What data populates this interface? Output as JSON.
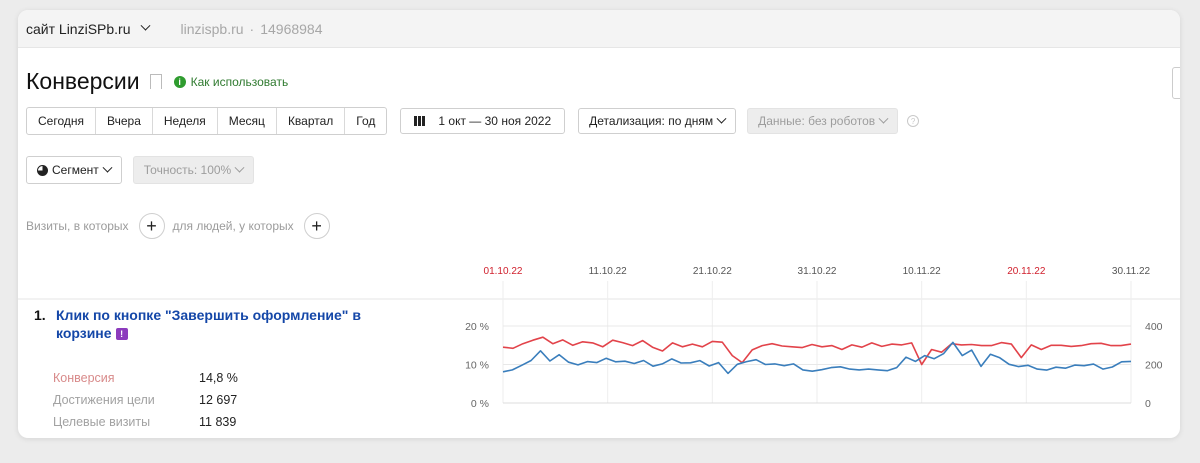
{
  "topbar": {
    "site_label": "сайт LinziSPb.ru",
    "domain": "linzispb.ru",
    "separator": "·",
    "counter_id": "14968984"
  },
  "page_title": "Конверсии",
  "help_link": "Как использовать",
  "info_glyph": "i",
  "periods": [
    "Сегодня",
    "Вчера",
    "Неделя",
    "Месяц",
    "Квартал",
    "Год"
  ],
  "date_range": "1 окт — 30 ноя 2022",
  "detail_label": "Детализация: по дням",
  "data_label": "Данные: без роботов",
  "help_glyph": "?",
  "segment_label": "Сегмент",
  "accuracy_label": "Точность: 100%",
  "filter": {
    "visits_label": "Визиты, в которых",
    "people_label": "для людей, у которых",
    "plus": "+"
  },
  "goal": {
    "number": "1.",
    "title": "Клик по кнопке \"Завершить оформление\" в корзине",
    "badge": "!",
    "stats": [
      {
        "label": "Конверсия",
        "value": "14,8 %"
      },
      {
        "label": "Достижения цели",
        "value": "12 697"
      },
      {
        "label": "Целевые визиты",
        "value": "11 839"
      }
    ]
  },
  "colors": {
    "conversion": "#e2434a",
    "visits": "#3a7ebc",
    "weekend_date": "#d0202d",
    "link": "#1447a8",
    "help": "#2f7a2f"
  },
  "chart_data": {
    "type": "line",
    "dates": [
      "01.10.22",
      "11.10.22",
      "21.10.22",
      "31.10.22",
      "10.11.22",
      "20.11.22",
      "30.11.22"
    ],
    "weekend_dates": [
      "01.10.22",
      "20.11.22"
    ],
    "y_left": {
      "ticks": [
        "20 %",
        "10 %",
        "0 %"
      ],
      "range": [
        0,
        20
      ]
    },
    "y_right": {
      "ticks": [
        "400",
        "200",
        "0"
      ],
      "range": [
        0,
        400
      ]
    },
    "series": [
      {
        "color": "#e2434a",
        "axis": "left",
        "values": [
          14.5,
          14.2,
          15.4,
          16.3,
          17.1,
          15.4,
          16.4,
          15.0,
          15.9,
          15.6,
          14.6,
          16.3,
          15.7,
          14.9,
          16.2,
          14.5,
          13.5,
          15.6,
          14.6,
          15.3,
          14.6,
          16.0,
          15.8,
          12.3,
          10.5,
          13.8,
          14.9,
          15.4,
          14.8,
          14.6,
          14.4,
          15.2,
          14.6,
          14.9,
          13.9,
          15.1,
          14.5,
          15.6,
          14.7,
          15.3,
          15.1,
          15.6,
          10.0,
          13.9,
          13.2,
          15.4,
          15.1,
          15.2,
          14.9,
          14.9,
          15.7,
          15.3,
          11.8,
          15.1,
          13.9,
          15.0,
          15.0,
          14.7,
          14.9,
          15.4,
          15.5,
          14.9,
          14.9,
          15.3
        ]
      },
      {
        "color": "#3a7ebc",
        "axis": "right",
        "values": [
          162,
          172,
          196,
          221,
          271,
          218,
          251,
          212,
          198,
          215,
          210,
          232,
          214,
          217,
          205,
          221,
          191,
          203,
          229,
          208,
          209,
          220,
          192,
          210,
          154,
          201,
          215,
          225,
          200,
          203,
          194,
          203,
          172,
          165,
          173,
          184,
          188,
          176,
          172,
          176,
          172,
          168,
          184,
          238,
          216,
          246,
          230,
          256,
          315,
          246,
          275,
          190,
          253,
          235,
          201,
          189,
          196,
          176,
          171,
          186,
          181,
          197,
          194,
          202,
          176,
          187,
          214,
          216
        ]
      }
    ]
  }
}
